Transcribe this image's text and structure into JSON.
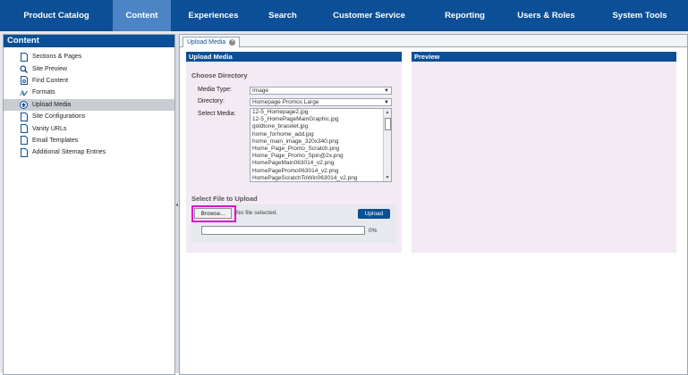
{
  "topnav": {
    "items": [
      {
        "label": "Product Catalog",
        "active": false
      },
      {
        "label": "Content",
        "active": true
      },
      {
        "label": "Experiences",
        "active": false
      },
      {
        "label": "Search",
        "active": false
      },
      {
        "label": "Customer Service",
        "active": false
      },
      {
        "label": "Reporting",
        "active": false
      },
      {
        "label": "Users & Roles",
        "active": false
      },
      {
        "label": "System Tools",
        "active": false
      }
    ]
  },
  "sidebar": {
    "title": "Content",
    "items": [
      {
        "label": "Sections & Pages",
        "icon": "document-icon"
      },
      {
        "label": "Site Preview",
        "icon": "magnifier-icon"
      },
      {
        "label": "Find Content",
        "icon": "find-document-icon"
      },
      {
        "label": "Formats",
        "icon": "formats-icon"
      },
      {
        "label": "Upload Media",
        "icon": "upload-icon",
        "selected": true
      },
      {
        "label": "Site Configurations",
        "icon": "document-icon"
      },
      {
        "label": "Vanity URLs",
        "icon": "document-icon"
      },
      {
        "label": "Email Templates",
        "icon": "document-icon"
      },
      {
        "label": "Additional Sitemap Entries",
        "icon": "document-icon"
      }
    ]
  },
  "tab": {
    "label": "Upload Media",
    "close_icon": "close-icon"
  },
  "upload_panel": {
    "title": "Upload Media",
    "choose_directory": "Choose Directory",
    "media_type_label": "Media Type:",
    "media_type_value": "Image",
    "directory_label": "Directory:",
    "directory_value": "Homepage Promos Large",
    "select_media_label": "Select Media:",
    "media_files": [
      "12-5_Homepage2.jpg",
      "12-5_HomePageMainGraphic.jpg",
      "goldtone_bracelet.jpg",
      "home_forhome_add.jpg",
      "home_main_image_320x340.png",
      "Home_Page_Promo_Scratch.png",
      "Home_Page_Promo_Spin@2x.png",
      "HomePageMain063014_v2.png",
      "HomePagePromo063014_v2.png",
      "HomePageScratchToWin063014_v2.png"
    ],
    "select_file": "Select File to Upload",
    "browse_label": "Browse...",
    "no_file": "No file selected.",
    "upload_label": "Upload",
    "progress_text": "0%",
    "progress_value": 0
  },
  "preview_panel": {
    "title": "Preview"
  },
  "colors": {
    "nav": "#0b4f96",
    "nav_active": "#4d84c5",
    "highlight": "#e010c8",
    "panel_bg": "#f3eaf4"
  }
}
